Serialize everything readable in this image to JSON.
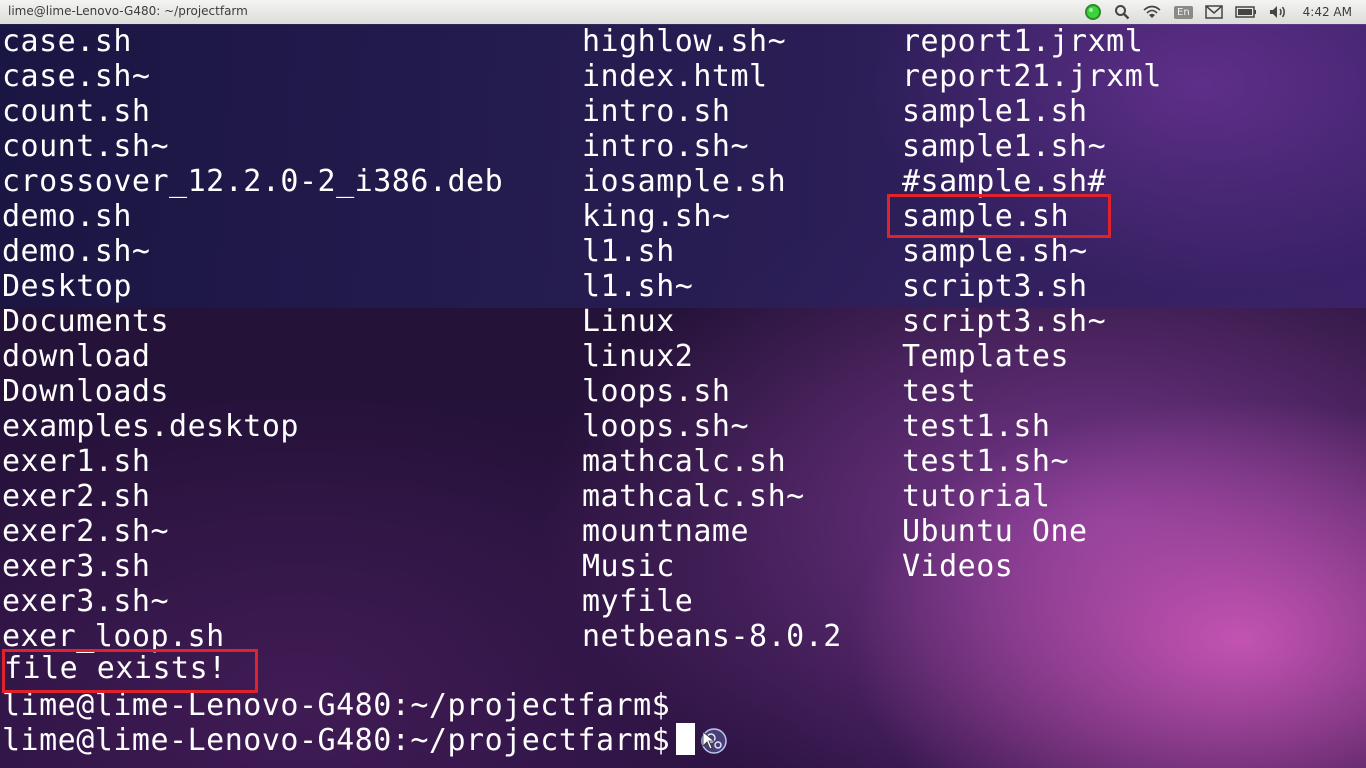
{
  "panel": {
    "window_title": "lime@lime-Lenovo-G480: ~/projectfarm",
    "language_indicator": "En",
    "clock": "4:42 AM",
    "tray_icons": [
      "status-green-icon",
      "search-icon",
      "wifi-icon",
      "language-indicator",
      "mail-icon",
      "battery-icon",
      "volume-icon"
    ]
  },
  "terminal": {
    "ls_columns": [
      [
        "case.sh",
        "case.sh~",
        "count.sh",
        "count.sh~",
        "crossover_12.2.0-2_i386.deb",
        "demo.sh",
        "demo.sh~",
        "Desktop",
        "Documents",
        "download",
        "Downloads",
        "examples.desktop",
        "exer1.sh",
        "exer2.sh",
        "exer2.sh~",
        "exer3.sh",
        "exer3.sh~",
        "exer_loop.sh"
      ],
      [
        "highlow.sh~",
        "index.html",
        "intro.sh",
        "intro.sh~",
        "iosample.sh",
        "king.sh~",
        "l1.sh",
        "l1.sh~",
        "Linux",
        "linux2",
        "loops.sh",
        "loops.sh~",
        "mathcalc.sh",
        "mathcalc.sh~",
        "mountname",
        "Music",
        "myfile",
        "netbeans-8.0.2"
      ],
      [
        "report1.jrxml",
        "report21.jrxml",
        "sample1.sh",
        "sample1.sh~",
        "#sample.sh#",
        "sample.sh",
        "sample.sh~",
        "script3.sh",
        "script3.sh~",
        "Templates",
        "test",
        "test1.sh",
        "test1.sh~",
        "tutorial",
        "Ubuntu One",
        "Videos"
      ]
    ],
    "output": "file exists!",
    "prompt1": "lime@lime-Lenovo-G480:~/projectfarm$",
    "prompt2": "lime@lime-Lenovo-G480:~/projectfarm$",
    "highlight_color": "#e0222a"
  }
}
